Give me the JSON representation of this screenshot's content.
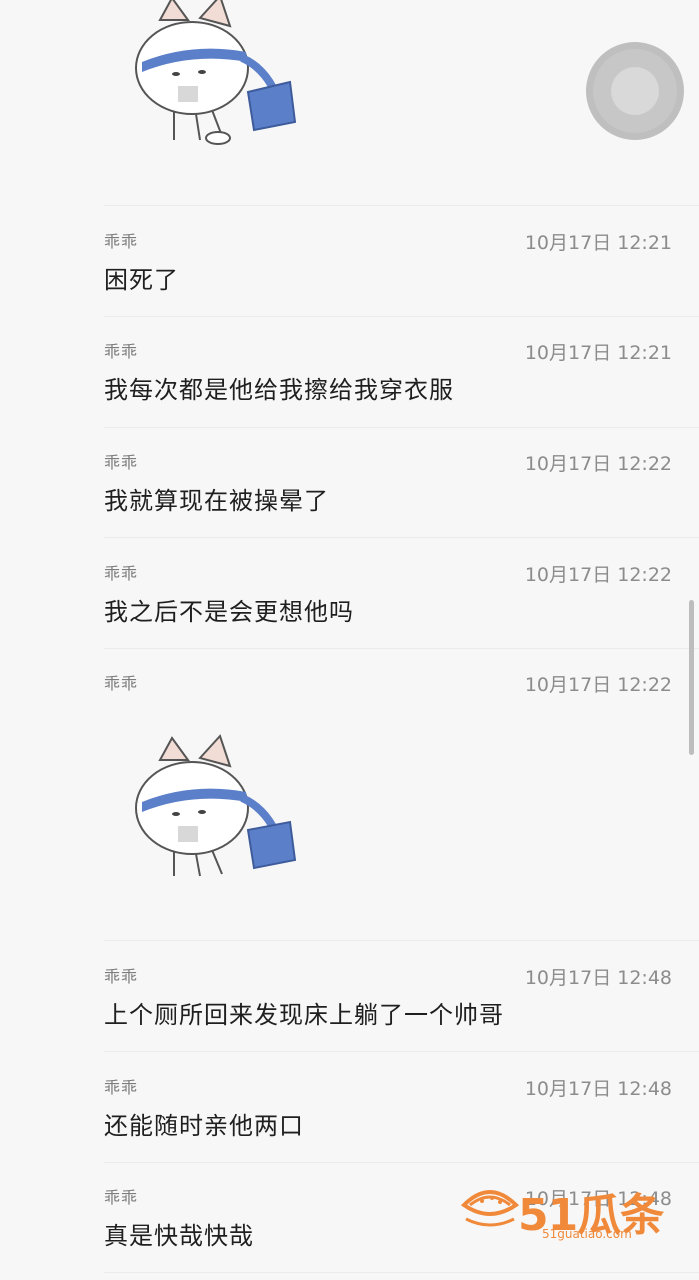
{
  "messages": [
    {
      "sender": "乖乖",
      "time": "10月17日 12:21",
      "text": "困死了"
    },
    {
      "sender": "乖乖",
      "time": "10月17日 12:21",
      "text": "我每次都是他给我擦给我穿衣服"
    },
    {
      "sender": "乖乖",
      "time": "10月17日 12:22",
      "text": "我就算现在被操晕了"
    },
    {
      "sender": "乖乖",
      "time": "10月17日 12:22",
      "text": "我之后不是会更想他吗"
    },
    {
      "sender": "乖乖",
      "time": "10月17日 12:22",
      "text": ""
    },
    {
      "sender": "乖乖",
      "time": "10月17日 12:48",
      "text": "上个厕所回来发现床上躺了一个帅哥"
    },
    {
      "sender": "乖乖",
      "time": "10月17日 12:48",
      "text": "还能随时亲他两口"
    },
    {
      "sender": "乖乖",
      "time": "10月17日 12:48",
      "text": "真是快哉快哉"
    }
  ],
  "watermark": {
    "brand": "51瓜条",
    "url": "51guatiao.com"
  },
  "colors": {
    "accent": "#f08a3a",
    "sticker_band": "#5b7fc9"
  }
}
